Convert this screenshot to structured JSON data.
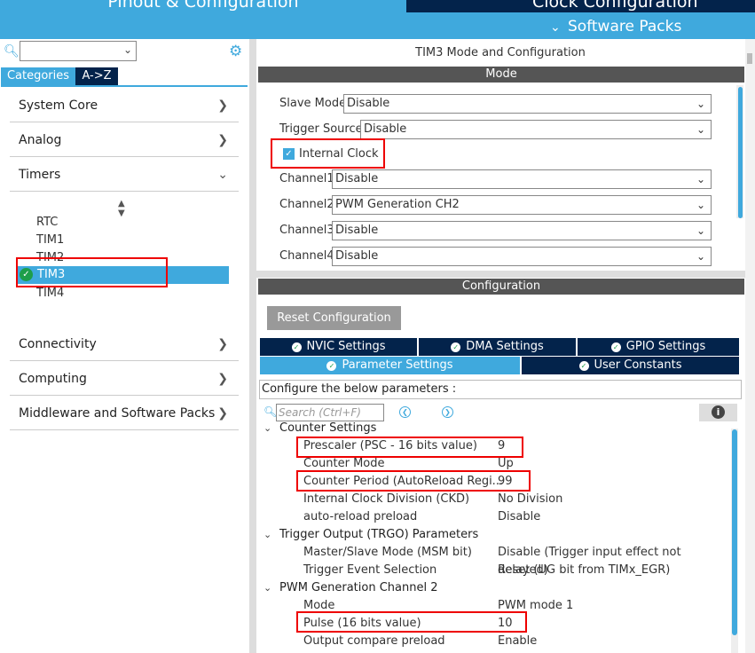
{
  "header": {
    "tab_pinout": "Pinout & Configuration",
    "tab_clock": "Clock Configuration",
    "software_packs": "Software Packs",
    "accent": "#3fa9dd",
    "dark": "#03234b"
  },
  "sidebar": {
    "search_value": "",
    "tabs": [
      "Categories",
      "A->Z"
    ],
    "categories": [
      {
        "label": "System Core"
      },
      {
        "label": "Analog"
      },
      {
        "label": "Timers"
      },
      {
        "label": "Connectivity"
      },
      {
        "label": "Computing"
      },
      {
        "label": "Middleware and Software Packs"
      }
    ],
    "timers": [
      "RTC",
      "TIM1",
      "TIM2",
      "TIM3",
      "TIM4"
    ]
  },
  "panel": {
    "title": "TIM3 Mode and Configuration",
    "mode_header": "Mode",
    "config_header": "Configuration",
    "mode_fields": {
      "slave_mode": {
        "label": "Slave Mode",
        "value": "Disable"
      },
      "trigger_source": {
        "label": "Trigger Source",
        "value": "Disable"
      },
      "internal_clock": {
        "label": "Internal Clock",
        "checked": true
      },
      "channel1": {
        "label": "Channel1",
        "value": "Disable"
      },
      "channel2": {
        "label": "Channel2",
        "value": "PWM Generation CH2"
      },
      "channel3": {
        "label": "Channel3",
        "value": "Disable"
      },
      "channel4": {
        "label": "Channel4",
        "value": "Disable"
      }
    },
    "reset_button": "Reset Configuration",
    "tabs": {
      "nvic": "NVIC Settings",
      "dma": "DMA Settings",
      "gpio": "GPIO Settings",
      "params": "Parameter Settings",
      "user_constants": "User Constants"
    },
    "configure_text": "Configure the below parameters :",
    "search_placeholder": "Search (Ctrl+F)",
    "groups": {
      "counter": "Counter Settings",
      "trgo": "Trigger Output (TRGO) Parameters",
      "pwm": "PWM Generation Channel 2"
    },
    "params": {
      "prescaler": {
        "name": "Prescaler (PSC - 16 bits value)",
        "value": "9"
      },
      "counter_mode": {
        "name": "Counter Mode",
        "value": "Up"
      },
      "counter_period": {
        "name": "Counter Period (AutoReload Regi...",
        "value": "99"
      },
      "clock_division": {
        "name": "Internal Clock Division (CKD)",
        "value": "No Division"
      },
      "autoreload": {
        "name": "auto-reload preload",
        "value": "Disable"
      },
      "msm": {
        "name": "Master/Slave Mode (MSM bit)",
        "value": "Disable (Trigger input effect not delayed)"
      },
      "trigger_event": {
        "name": "Trigger Event Selection",
        "value": "Reset (UG bit from TIMx_EGR)"
      },
      "mode": {
        "name": "Mode",
        "value": "PWM mode 1"
      },
      "pulse": {
        "name": "Pulse (16 bits value)",
        "value": "10"
      },
      "oc_preload": {
        "name": "Output compare preload",
        "value": "Enable"
      }
    }
  }
}
